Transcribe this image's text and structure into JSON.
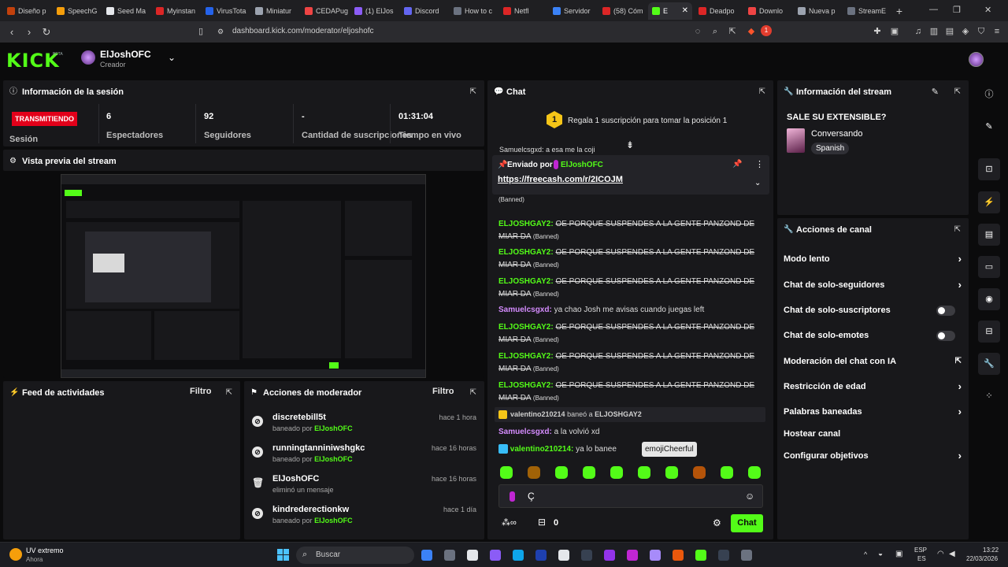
{
  "browser": {
    "tabs": [
      {
        "label": "Diseño p",
        "color": "#c2410c"
      },
      {
        "label": "SpeechG",
        "color": "#f59e0b"
      },
      {
        "label": "Seed Ma",
        "color": "#e5e7eb"
      },
      {
        "label": "Myinstan",
        "color": "#dc2626"
      },
      {
        "label": "VirusTota",
        "color": "#2563eb"
      },
      {
        "label": "Miniatur",
        "color": "#9ca3af"
      },
      {
        "label": "CEDAPug",
        "color": "#ef4444"
      },
      {
        "label": "(1) ElJos",
        "color": "#8b5cf6"
      },
      {
        "label": "Discord",
        "color": "#6366f1"
      },
      {
        "label": "How to c",
        "color": "#6b7280"
      },
      {
        "label": "Netfl",
        "color": "#dc2626"
      },
      {
        "label": "Servidor",
        "color": "#3b82f6"
      },
      {
        "label": "(58) Cóm",
        "color": "#dc2626"
      },
      {
        "label": "E",
        "color": "#53fc18"
      },
      {
        "label": "Deadpo",
        "color": "#dc2626"
      },
      {
        "label": "Downlo",
        "color": "#ef4444"
      },
      {
        "label": "Nueva p",
        "color": "#9ca3af"
      },
      {
        "label": "StreamE",
        "color": "#6b7280"
      }
    ],
    "url": "dashboard.kick.com/moderator/eljoshofc",
    "brave_badge": "1"
  },
  "header": {
    "logo": "KICK",
    "beta": "BETA",
    "channel_name": "ElJoshOFC",
    "channel_role": "Creador"
  },
  "session": {
    "title": "Información de la sesión",
    "live_badge": "TRANSMITIENDO",
    "session_label": "Sesión",
    "stats": [
      {
        "value": "6",
        "label": "Espectadores"
      },
      {
        "value": "92",
        "label": "Seguidores"
      },
      {
        "value": "-",
        "label": "Cantidad de suscripciones"
      },
      {
        "value": "01:31:04",
        "label": "Tiempo en vivo"
      }
    ]
  },
  "preview": {
    "title": "Vista previa del stream"
  },
  "activity": {
    "title": "Feed de actividades",
    "filter": "Filtro"
  },
  "mod_actions": {
    "title": "Acciones de moderador",
    "filter": "Filtro",
    "items": [
      {
        "name": "discretebill5t",
        "action": "baneado por",
        "by": "ElJoshOFC",
        "time": "hace 1 hora",
        "icon": "ban-icon"
      },
      {
        "name": "runningtanniniwshgkc",
        "action": "baneado por",
        "by": "ElJoshOFC",
        "time": "hace 16 horas",
        "icon": "ban-icon"
      },
      {
        "name": "ElJoshOFC",
        "action": "eliminó un mensaje",
        "by": "",
        "time": "hace 16 horas",
        "icon": "trash-icon"
      },
      {
        "name": "kindrederectionkw",
        "action": "baneado por",
        "by": "ElJoshOFC",
        "time": "hace 1 día",
        "icon": "ban-icon"
      }
    ]
  },
  "chat": {
    "title": "Chat",
    "gift_text": "Regala 1 suscripción para tomar la posición 1",
    "gift_rank": "1",
    "cut_line": "Samuelcsgxd: a esa me la coji",
    "pinned": {
      "sent_by": "Enviado por",
      "author": "ElJoshOFC",
      "link": "https://freecash.com/r/2ICOJM"
    },
    "banned_text": "OE PORQUE SUSPENDES A LA GENTE PANZOND DE MIAR DA",
    "banned_label": "(Banned)",
    "banned_user": "ELJOSHGAY2:",
    "samuel_user": "Samuelcsgxd:",
    "samuel_msg": "ya chao Josh me avisas cuando juegas left",
    "ban_notice": {
      "mod": "valentino210214",
      "verb": "baneó a",
      "target": "ELJOSHGAY2"
    },
    "samuel_msg2": "a la volvió xd",
    "valentino_user": "valentino210214:",
    "valentino_msg": "ya lo banee",
    "emote_tooltip": "emojiCheerful",
    "input_value": "Ç",
    "points": "0",
    "send_label": "Chat",
    "emote_colors": [
      "#53fc18",
      "#a16207",
      "#53fc18",
      "#53fc18",
      "#53fc18",
      "#53fc18",
      "#53fc18",
      "#b45309",
      "#53fc18",
      "#53fc18"
    ]
  },
  "stream_info": {
    "title": "Información del stream",
    "stream_title": "SALE SU EXTENSIBLE?",
    "category": "Conversando",
    "language": "Spanish"
  },
  "channel_actions": {
    "title": "Acciones de canal",
    "items": [
      {
        "label": "Modo lento",
        "control": "arrow"
      },
      {
        "label": "Chat de solo-seguidores",
        "control": "arrow"
      },
      {
        "label": "Chat de solo-suscriptores",
        "control": "toggle"
      },
      {
        "label": "Chat de solo-emotes",
        "control": "toggle"
      },
      {
        "label": "Moderación del chat con IA",
        "control": "external"
      },
      {
        "label": "Restricción de edad",
        "control": "arrow"
      },
      {
        "label": "Palabras baneadas",
        "control": "arrow"
      },
      {
        "label": "Hostear canal",
        "control": "none"
      },
      {
        "label": "Configurar objetivos",
        "control": "arrow"
      }
    ]
  },
  "taskbar": {
    "weather_temp": "UV extremo",
    "weather_sub": "Ahora",
    "search": "Buscar",
    "lang_top": "ESP",
    "lang_bottom": "ES",
    "time": "13:22",
    "date": "22/03/2026"
  }
}
